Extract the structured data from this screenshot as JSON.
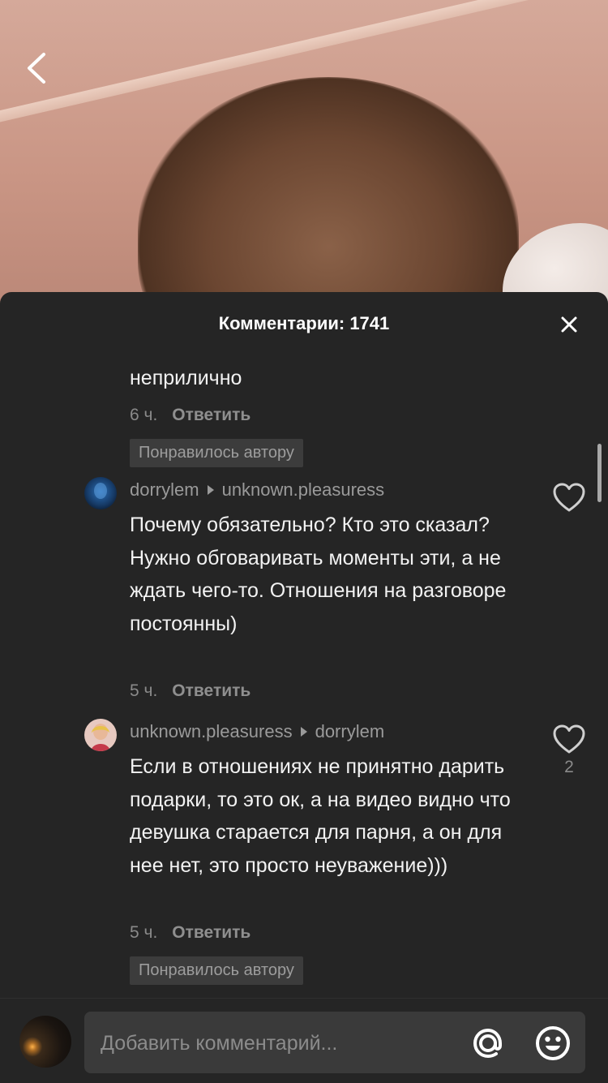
{
  "header": {
    "comments_title": "Комментарии: 1741"
  },
  "comments": {
    "partial": {
      "text_tail": "неприлично",
      "time": "6 ч.",
      "reply_label": "Ответить",
      "liked_badge": "Понравилось автору"
    },
    "items": [
      {
        "author": "dorrylem",
        "reply_to": "unknown.pleasuress",
        "text": "Почему обязательно? Кто это сказал? Нужно обговаривать моменты эти, а не ждать чего-то. Отношения на разговоре постоянны)",
        "time": "5 ч.",
        "reply_label": "Ответить",
        "likes": ""
      },
      {
        "author": "unknown.pleasuress",
        "reply_to": "dorrylem",
        "text": "Если в отношениях не принятно дарить подарки, то это ок, а на видео видно что девушка старается для парня, а он для нее нет, это просто неуважение)))",
        "time": "5 ч.",
        "reply_label": "Ответить",
        "likes": "2",
        "liked_badge": "Понравилось автору"
      }
    ]
  },
  "composer": {
    "placeholder": "Добавить комментарий..."
  },
  "icons": {
    "back": "chevron-left-icon",
    "close": "close-icon",
    "like": "heart-outline-icon",
    "mention": "at-sign-icon",
    "emoji": "smiley-icon"
  },
  "colors": {
    "sheet_bg": "#252525",
    "input_bg": "#3a3a3a",
    "muted_text": "#8a8a8a",
    "badge_bg": "#3c3c3c"
  }
}
